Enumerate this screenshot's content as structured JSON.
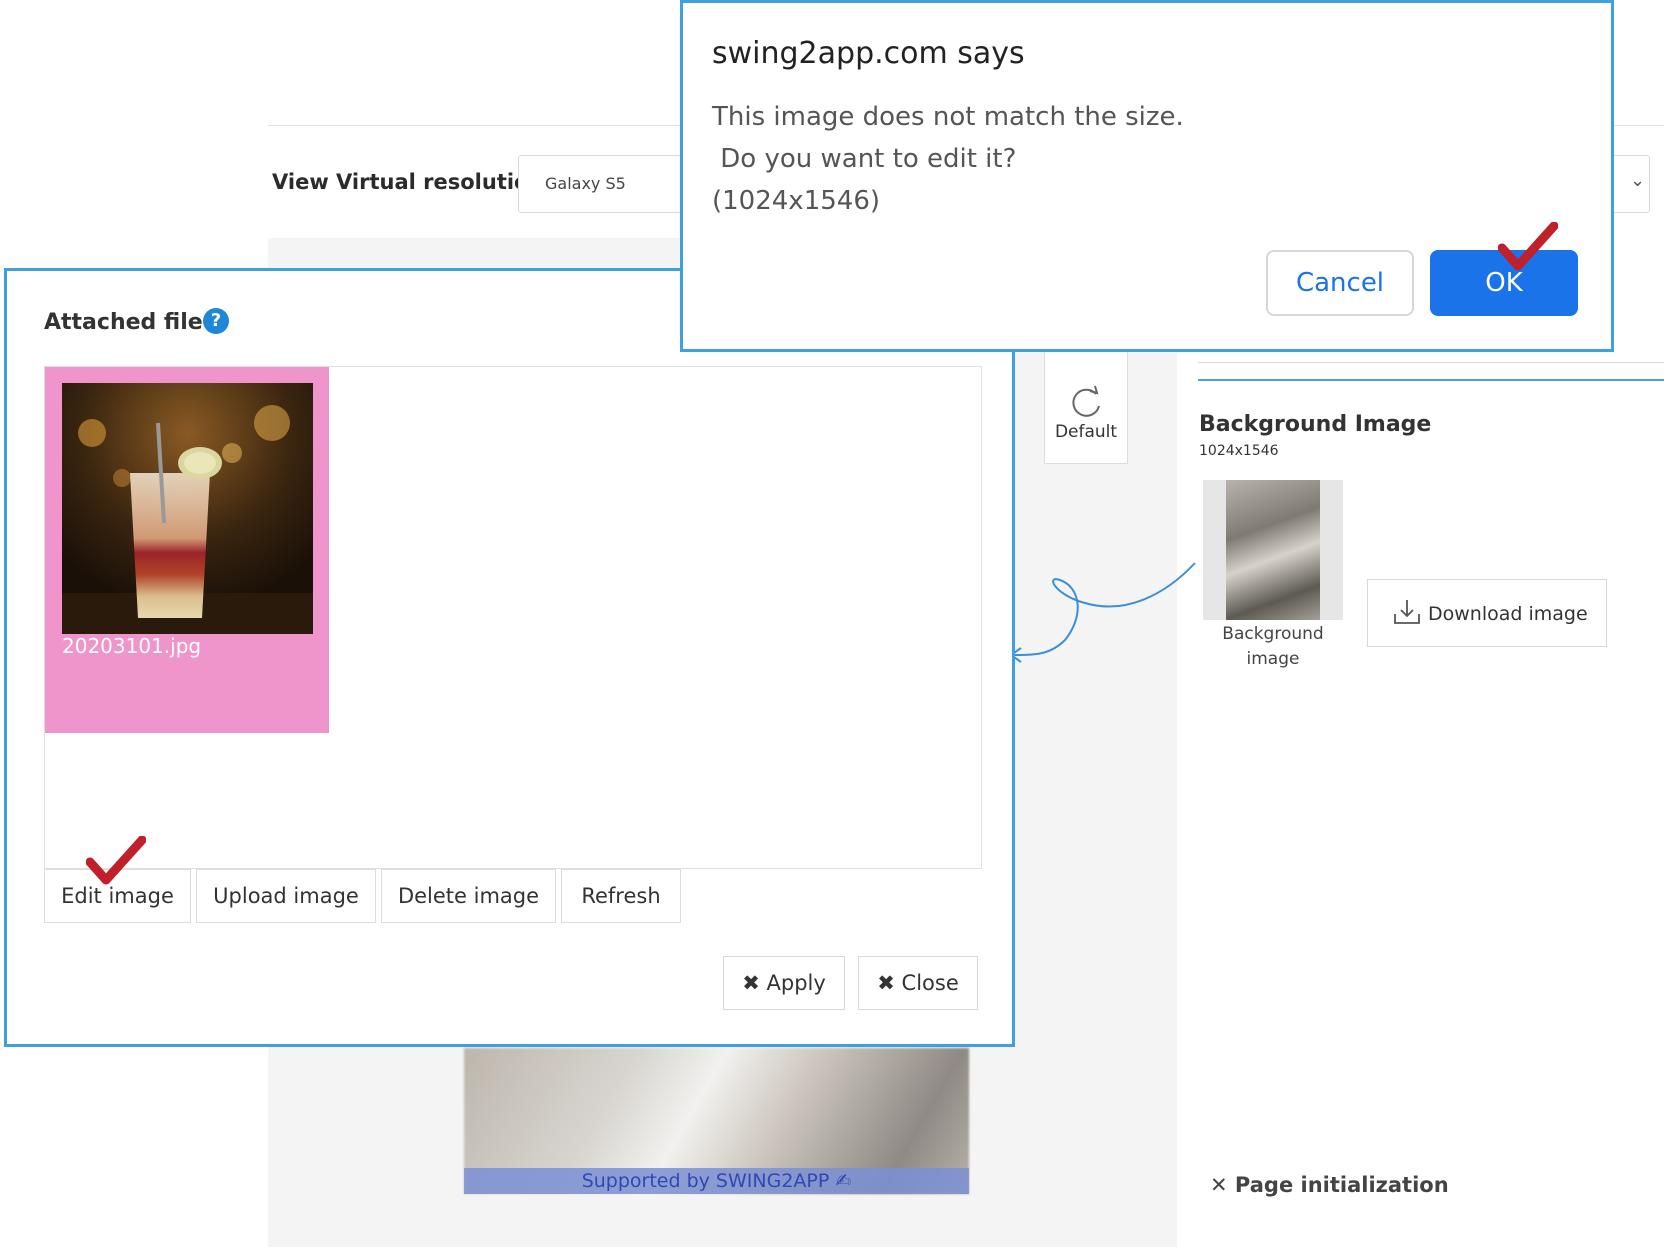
{
  "resolution": {
    "label": "View Virtual resolution",
    "selected": "Galaxy S5"
  },
  "toolbar": {
    "default_label": "Default"
  },
  "background_image": {
    "title": "Background Image",
    "size": "1024x1546",
    "caption_line1": "Background",
    "caption_line2": "image",
    "download_label": "Download image"
  },
  "page_init_label": "Page initialization",
  "preview": {
    "support_text": "Supported by SWING2APP"
  },
  "file_dialog": {
    "title": "Attached file",
    "help_glyph": "?",
    "file": {
      "name": "20203101.jpg"
    },
    "buttons": {
      "edit": "Edit image",
      "upload": "Upload image",
      "delete": "Delete image",
      "refresh": "Refresh"
    },
    "apply_label": "Apply",
    "close_label": "Close"
  },
  "alert": {
    "title": "swing2app.com says",
    "message": "This image does not match the size.\n Do you want to edit it?\n(1024x1546)",
    "cancel_label": "Cancel",
    "ok_label": "OK"
  },
  "colors": {
    "accent_blue": "#3da1e1",
    "ok_blue": "#1a73e8",
    "tile_pink": "#ef95cb",
    "check_red": "#c0202a"
  },
  "icons": [
    "help-icon",
    "refresh-icon",
    "download-icon",
    "close-icon",
    "checkmark-icon",
    "chevron-down-icon",
    "pen-icon"
  ]
}
